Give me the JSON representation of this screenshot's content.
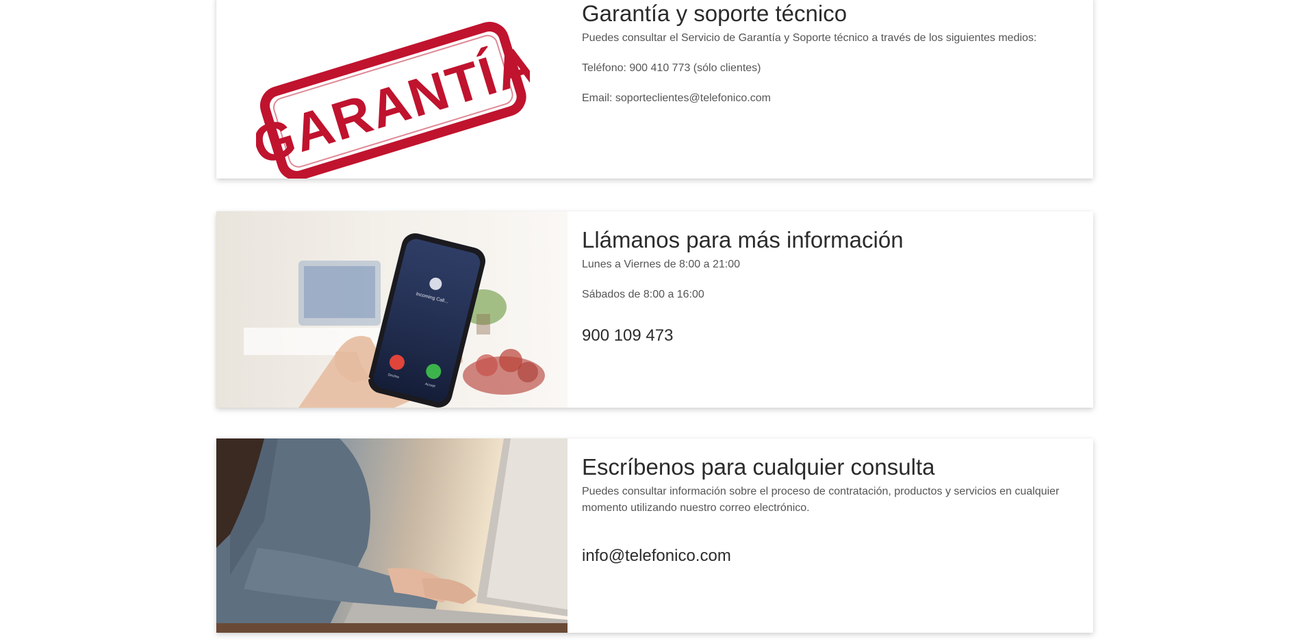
{
  "cards": [
    {
      "title": "Garantía y soporte técnico",
      "lines": [
        "Puedes consultar el Servicio de Garantía y Soporte técnico a través de los siguientes medios:",
        "Teléfono: 900 410 773 (sólo clientes)",
        "Email: soporteclientes@telefonico.com"
      ],
      "image": {
        "stamp_text": "GARANTÍA",
        "stamp_color": "#c0132e"
      }
    },
    {
      "title": "Llámanos para más información",
      "lines": [
        "Lunes a Viernes de 8:00 a 21:00",
        "Sábados de 8:00 a 16:00"
      ],
      "contact": "900 109 473",
      "image": {
        "caller_label": "Incoming Call...",
        "decline_label": "Decline",
        "accept_label": "Accept",
        "decline_color": "#e0443a",
        "accept_color": "#3cb44b"
      }
    },
    {
      "title": "Escríbenos para cualquier consulta",
      "lines": [
        "Puedes consultar información sobre el proceso de contratación, productos y servicios en cualquier momento utilizando nuestro correo electrónico."
      ],
      "contact": "info@telefonico.com"
    }
  ]
}
